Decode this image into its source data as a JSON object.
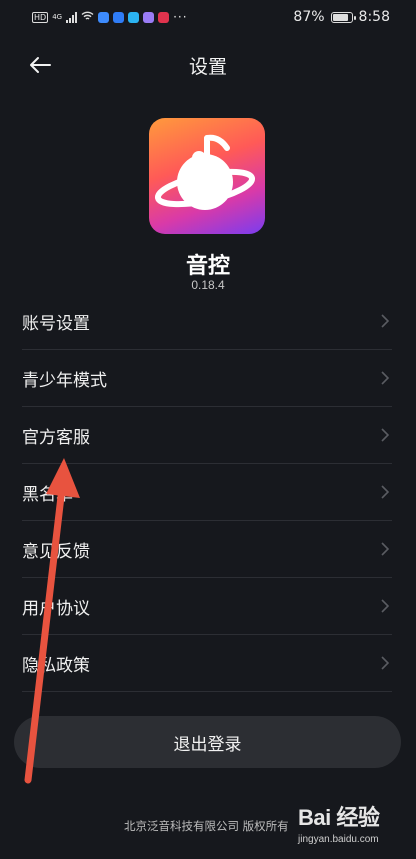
{
  "status_bar": {
    "left_chip": "HD",
    "net_label": "4G",
    "battery": "87%",
    "time": "8:58"
  },
  "header": {
    "title": "设置"
  },
  "app": {
    "name": "音控",
    "version": "0.18.4"
  },
  "menu": {
    "items": [
      {
        "label": "账号设置"
      },
      {
        "label": "青少年模式"
      },
      {
        "label": "官方客服"
      },
      {
        "label": "黑名单"
      },
      {
        "label": "意见反馈"
      },
      {
        "label": "用户协议"
      },
      {
        "label": "隐私政策"
      }
    ]
  },
  "logout": {
    "label": "退出登录"
  },
  "footer": {
    "copyright": "北京泛音科技有限公司 版权所有"
  },
  "watermark": {
    "brand": "Bai 经验",
    "url": "jingyan.baidu.com"
  },
  "colors": {
    "background": "#16181d",
    "button": "#2c2e33",
    "arrow": "#e8533f"
  }
}
